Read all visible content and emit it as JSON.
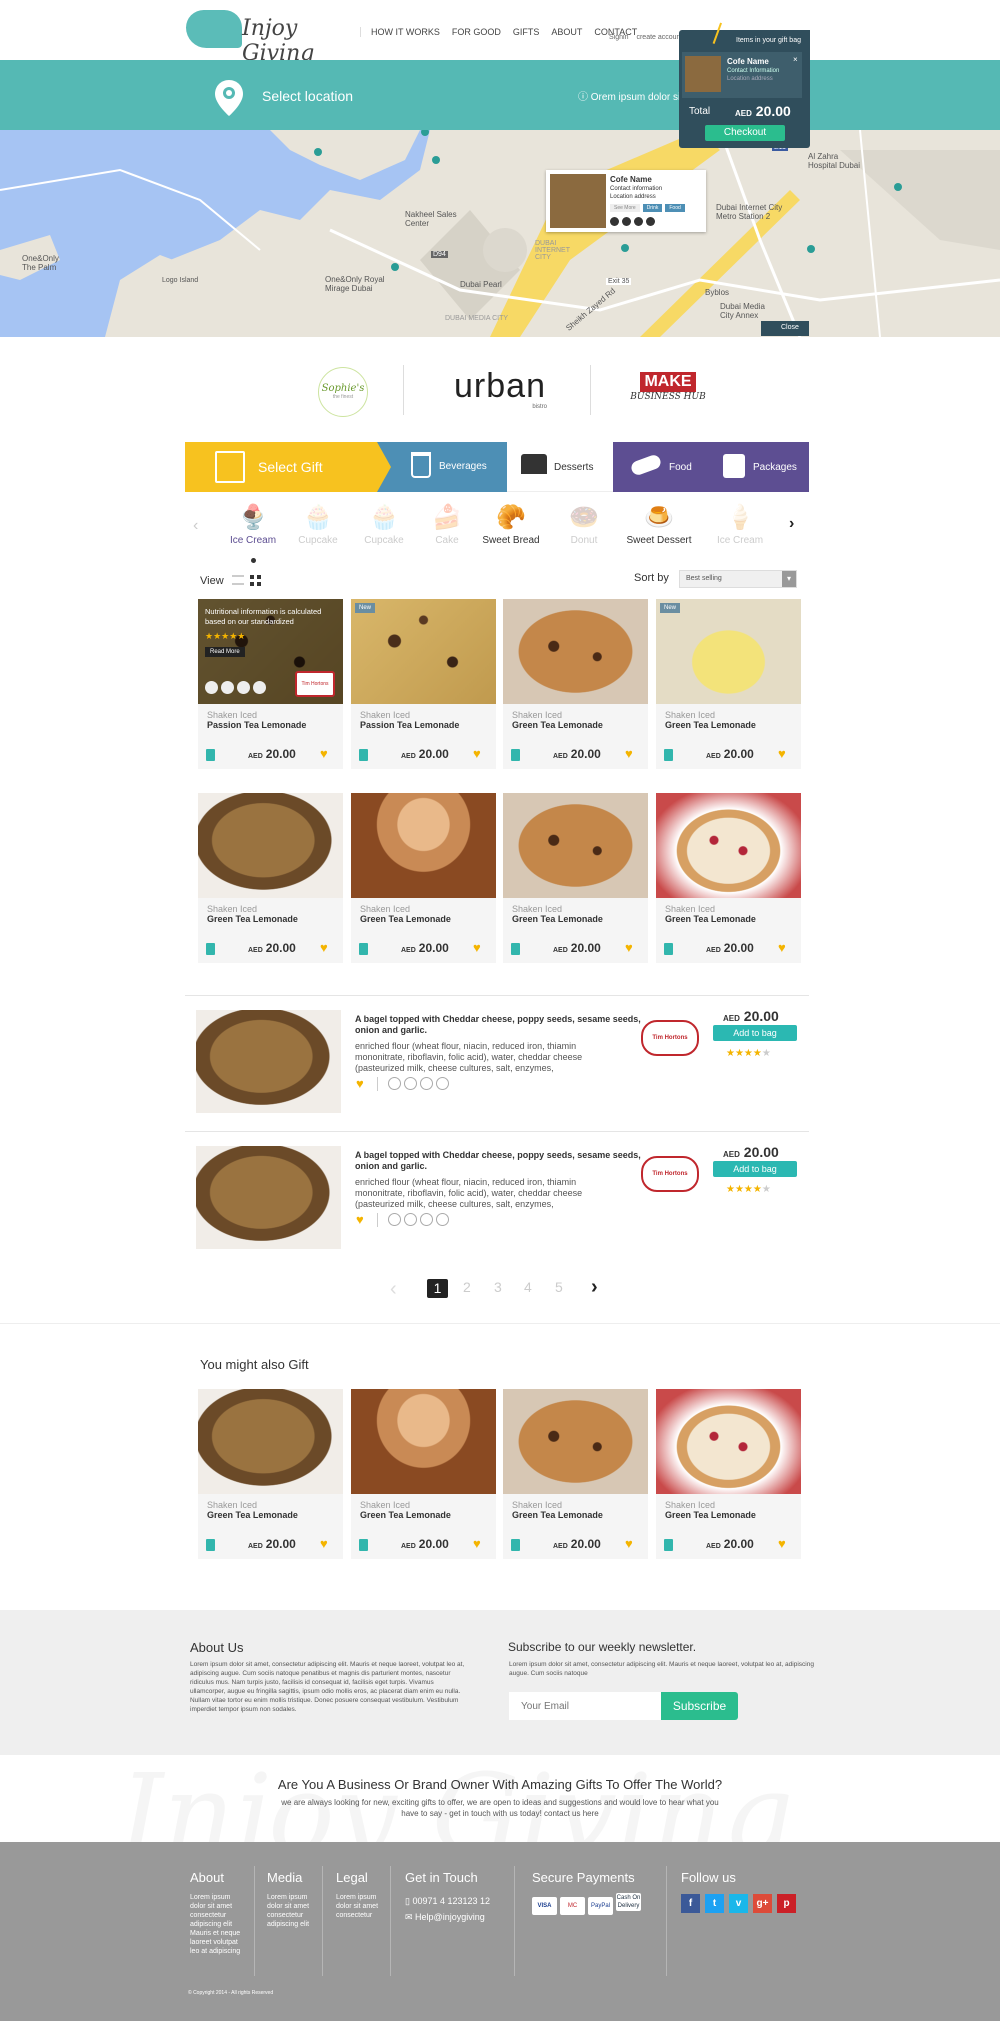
{
  "header": {
    "logo_text": "Injoy Giving",
    "nav": [
      "HOW IT WORKS",
      "FOR GOOD",
      "GIFTS",
      "ABOUT",
      "CONTACT"
    ],
    "signin": "Signin",
    "create_account": "create account",
    "bag_tab": "Items in your gift bag"
  },
  "location": {
    "label": "Select location",
    "info": "Orem ipsum dolor sit a"
  },
  "giftbag": {
    "item_name": "Cofe Name",
    "item_contact": "Contact Information",
    "item_address": "Location address",
    "total_label": "Total",
    "total_currency": "AED",
    "total_value": "20.00",
    "checkout": "Checkout"
  },
  "map": {
    "popup_name": "Cofe Name",
    "popup_contact": "Contact information",
    "popup_address": "Location address",
    "popup_tags": [
      "See More",
      "Drink",
      "Food"
    ],
    "close": "Close",
    "labels": [
      "Nakheel Sales Center",
      "Dubai Pearl",
      "One&Only Royal Mirage Dubai",
      "One&Only The Palm",
      "Logo Island",
      "Dubai Internet City Metro Station 2",
      "Byblos",
      "Dubai Media City Annex",
      "Al Zahra Hospital Dubai",
      "Exit 35",
      "DUBAI INTERNET CITY",
      "DUBAI MEDIA CITY",
      "Sheikh Zayed Rd",
      "D94",
      "E11"
    ]
  },
  "brands": [
    {
      "name": "Sophie's",
      "tag": "the finest"
    },
    {
      "name": "urban",
      "tag": "bistro"
    },
    {
      "name": "MAKE",
      "tag": "BUSINESS HUB"
    }
  ],
  "tabs": {
    "select_gift": "Select Gift",
    "items": [
      "Beverages",
      "Desserts",
      "Food",
      "Packages"
    ]
  },
  "categories": [
    "Ice Cream",
    "Cupcake",
    "Cupcake",
    "Cake",
    "Sweet Bread",
    "Donut",
    "Sweet Dessert",
    "Ice Cream"
  ],
  "toolbar": {
    "view_label": "View",
    "sort_label": "Sort by",
    "sort_value": "Best selling"
  },
  "products": [
    {
      "sub": "Shaken Iced",
      "name": "Passion Tea Lemonade",
      "currency": "AED",
      "price": "20.00",
      "img": "bar",
      "overlay": "Nutritional information is calculated based on our standardized",
      "read_more": "Read More",
      "brand": "Tim Hortons"
    },
    {
      "sub": "Shaken Iced",
      "name": "Passion Tea Lemonade",
      "currency": "AED",
      "price": "20.00",
      "img": "bar",
      "badge": "New"
    },
    {
      "sub": "Shaken Iced",
      "name": "Green Tea Lemonade",
      "currency": "AED",
      "price": "20.00",
      "img": "cookie"
    },
    {
      "sub": "Shaken Iced",
      "name": "Green Tea Lemonade",
      "currency": "AED",
      "price": "20.00",
      "img": "drink",
      "badge": "New"
    },
    {
      "sub": "Shaken Iced",
      "name": "Green Tea Lemonade",
      "currency": "AED",
      "price": "20.00",
      "img": "muffin"
    },
    {
      "sub": "Shaken Iced",
      "name": "Green Tea Lemonade",
      "currency": "AED",
      "price": "20.00",
      "img": "coffee"
    },
    {
      "sub": "Shaken Iced",
      "name": "Green Tea Lemonade",
      "currency": "AED",
      "price": "20.00",
      "img": "cookie"
    },
    {
      "sub": "Shaken Iced",
      "name": "Green Tea Lemonade",
      "currency": "AED",
      "price": "20.00",
      "img": "danish"
    }
  ],
  "list_items": [
    {
      "title": "A bagel topped with Cheddar cheese, poppy seeds, sesame seeds, onion and garlic.",
      "desc": "enriched flour (wheat flour, niacin, reduced iron, thiamin mononitrate, riboflavin, folic acid), water, cheddar cheese (pasteurized milk, cheese cultures, salt, enzymes,",
      "currency": "AED",
      "price": "20.00",
      "add": "Add to bag",
      "brand": "Tim Hortons",
      "stars": 4
    },
    {
      "title": "A bagel topped with Cheddar cheese, poppy seeds, sesame seeds, onion and garlic.",
      "desc": "enriched flour (wheat flour, niacin, reduced iron, thiamin mononitrate, riboflavin, folic acid), water, cheddar cheese (pasteurized milk, cheese cultures, salt, enzymes,",
      "currency": "AED",
      "price": "20.00",
      "add": "Add to bag",
      "brand": "Tim Hortons",
      "stars": 4
    }
  ],
  "pagination": [
    "1",
    "2",
    "3",
    "4",
    "5"
  ],
  "also": {
    "title": "You might also Gift",
    "items": [
      {
        "sub": "Shaken Iced",
        "name": "Green Tea Lemonade",
        "currency": "AED",
        "price": "20.00",
        "img": "muffin"
      },
      {
        "sub": "Shaken Iced",
        "name": "Green Tea Lemonade",
        "currency": "AED",
        "price": "20.00",
        "img": "coffee"
      },
      {
        "sub": "Shaken Iced",
        "name": "Green Tea Lemonade",
        "currency": "AED",
        "price": "20.00",
        "img": "cookie"
      },
      {
        "sub": "Shaken Iced",
        "name": "Green Tea Lemonade",
        "currency": "AED",
        "price": "20.00",
        "img": "danish"
      }
    ]
  },
  "about": {
    "title": "About Us",
    "text": "Lorem ipsum dolor sit amet, consectetur adipiscing elit. Mauris et neque laoreet, volutpat leo at, adipiscing augue. Cum sociis natoque penatibus et magnis dis parturient montes, nascetur ridiculus mus. Nam turpis justo, facilisis id consequat id, facilisis eget turpis. Vivamus ullamcorper, augue eu fringilla sagittis, ipsum odio mollis eros, ac placerat diam enim eu nulla. Nullam vitae tortor eu enim mollis tristique. Donec posuere consequat vestibulum. Vestibulum imperdiet tempor ipsum non sodales."
  },
  "newsletter": {
    "title": "Subscribe to our weekly newsletter.",
    "text": "Lorem ipsum dolor sit amet, consectetur adipiscing elit. Mauris et neque laoreet, volutpat leo at, adipiscing augue. Cum sociis natoque",
    "placeholder": "Your Email",
    "button": "Subscribe"
  },
  "business": {
    "title": "Are You A Business Or Brand Owner With Amazing Gifts To Offer The World?",
    "text": "we are always looking for new, exciting gifts to offer, we are open to ideas and suggestions and would love to hear what you have to say - get in touch with us today! contact us here"
  },
  "footer": {
    "about_title": "About",
    "about_text": "Lorem ipsum dolor sit amet consectetur adipiscing elit Mauris et neque laoreet volutpat leo at adipiscing",
    "media_title": "Media",
    "media_text": "Lorem ipsum dolor sit amet consectetur adipiscing elit",
    "legal_title": "Legal",
    "legal_text": "Lorem ipsum dolor sit amet consectetur",
    "contact_title": "Get in Touch",
    "phone": "00971 4 123123 12",
    "email": "Help@injoygiving",
    "payments_title": "Secure Payments",
    "payments": [
      "VISA",
      "MC",
      "PayPal",
      "Cash On Delivery"
    ],
    "follow_title": "Follow us",
    "social": [
      "f",
      "t",
      "v",
      "g+",
      "p"
    ],
    "copyright": "© Copyright 2014 - All rights Reserved"
  },
  "colors": {
    "teal": "#55b9b4",
    "yellow": "#f7c21f",
    "blue": "#4d8fb5",
    "purple": "#5d4e92",
    "green": "#2bbd8e",
    "star": "#f4b400"
  }
}
